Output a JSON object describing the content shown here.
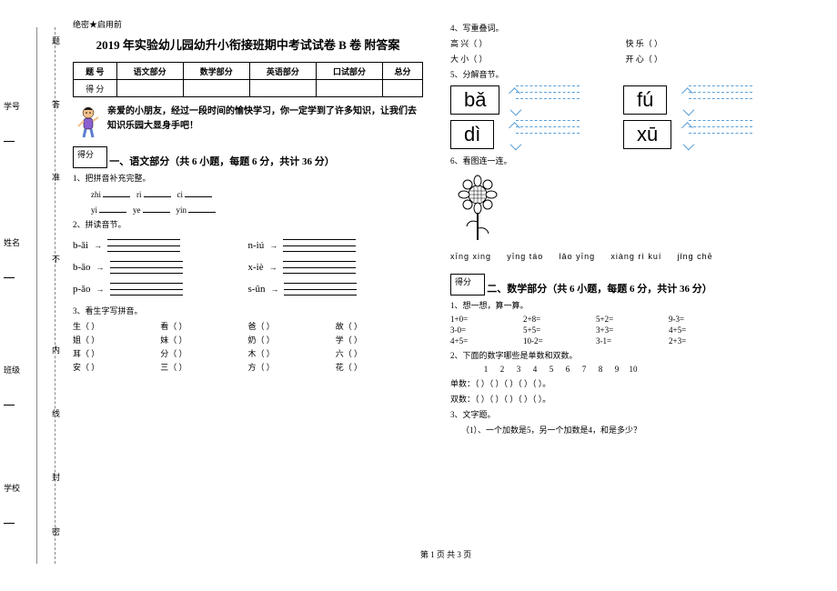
{
  "binding": {
    "labels": {
      "xuehao": "学号",
      "xingming": "姓名",
      "banji": "班级",
      "xuexiao": "学校"
    },
    "cut": {
      "a": "题",
      "b": "答",
      "c": "准",
      "d": "不",
      "e": "内",
      "f": "线",
      "g": "封",
      "h": "密"
    }
  },
  "header": {
    "secret": "绝密★启用前",
    "title": "2019 年实验幼儿园幼升小衔接班期中考试试卷 B 卷 附答案"
  },
  "scoretable": {
    "r1": [
      "题 号",
      "语文部分",
      "数学部分",
      "英语部分",
      "口试部分",
      "总分"
    ],
    "r2": "得 分"
  },
  "intro": "亲爱的小朋友，经过一段时间的愉快学习，你一定学到了许多知识，让我们去知识乐园大显身手吧！",
  "scorebox": "得分",
  "sec1": {
    "title": "一、语文部分（共 6 小题，每题 6 分，共计 36 分）",
    "q1": "1、把拼音补充完整。",
    "q1a": [
      "zhi",
      "ri",
      "ci"
    ],
    "q1b": [
      "yi",
      "ye",
      "yin"
    ],
    "q2": "2、拼读音节。",
    "pairs": [
      [
        "b-ǎi",
        "n-iú"
      ],
      [
        "b-āo",
        "x-iè"
      ],
      [
        "p-ǎo",
        "s-ūn"
      ]
    ],
    "q3": "3、看生字写拼音。",
    "chars": [
      [
        "生（",
        "看（",
        "爸（",
        "故（"
      ],
      [
        "姐（",
        "妹（",
        "奶（",
        "学（"
      ],
      [
        "耳（",
        "分（",
        "木（",
        "六（"
      ],
      [
        "安（",
        "三（",
        "方（",
        "花（"
      ]
    ]
  },
  "right": {
    "q4": "4、写重叠词。",
    "redup": [
      [
        "高 兴（",
        "快 乐（"
      ],
      [
        "大 小（",
        "开 心（"
      ]
    ],
    "q5": "5、分解音节。",
    "sylls": [
      [
        "bǎ",
        "fú"
      ],
      [
        "dì",
        "xū"
      ]
    ],
    "q6": "6、看图连一连。",
    "pwords": [
      "xīng xing",
      "yīng táo",
      "lǎo yīng",
      "xiàng rì kuí",
      "jǐng chē"
    ]
  },
  "sec2": {
    "title": "二、数学部分（共 6 小题，每题 6 分，共计 36 分）",
    "q1": "1、想一想，算一算。",
    "rows": [
      [
        "1+0=",
        "2+8=",
        "5+2=",
        "9-3="
      ],
      [
        "3-0=",
        "5+5=",
        "3+3=",
        "4+5="
      ],
      [
        "4+5=",
        "10-2=",
        "3-1=",
        "2+3="
      ]
    ],
    "q2": "2、下面的数字哪些是单数和双数。",
    "nums": [
      "1",
      "2",
      "3",
      "4",
      "5",
      "6",
      "7",
      "8",
      "9",
      "10"
    ],
    "odd_lbl": "单数：（",
    "even_lbl": "双数：（",
    "close": "）。",
    "q3": "3、文字题。",
    "q3a": "（1）、一个加数是5，另一个加数是4，和是多少？"
  },
  "footer": "第 1 页 共 3 页"
}
